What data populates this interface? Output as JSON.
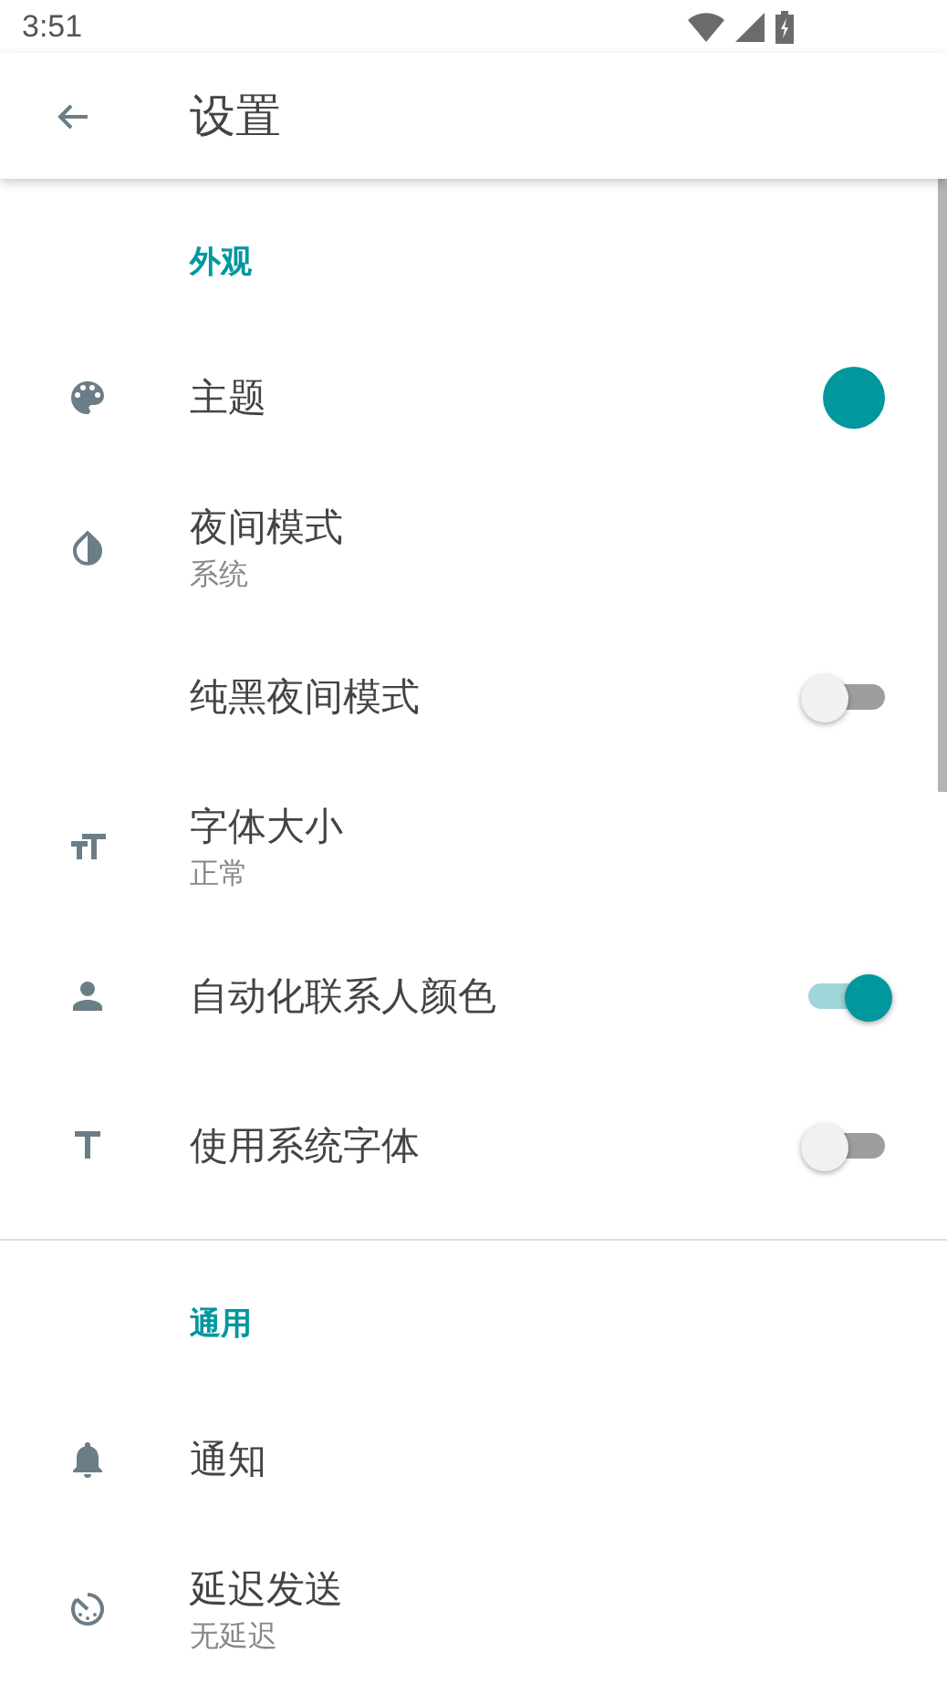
{
  "status_bar": {
    "time": "3:51"
  },
  "toolbar": {
    "title": "设置"
  },
  "sections": [
    {
      "header": "外观",
      "items": [
        {
          "kind": "color",
          "title": "主题",
          "color": "#00979d"
        },
        {
          "kind": "plain",
          "title": "夜间模式",
          "summary": "系统"
        },
        {
          "kind": "switch",
          "title": "纯黑夜间模式",
          "on": false
        },
        {
          "kind": "plain",
          "title": "字体大小",
          "summary": "正常"
        },
        {
          "kind": "switch",
          "title": "自动化联系人颜色",
          "on": true
        },
        {
          "kind": "switch",
          "title": "使用系统字体",
          "on": false
        }
      ]
    },
    {
      "header": "通用",
      "items": [
        {
          "kind": "plain",
          "title": "通知"
        },
        {
          "kind": "plain",
          "title": "延迟发送",
          "summary": "无延迟"
        }
      ]
    }
  ]
}
